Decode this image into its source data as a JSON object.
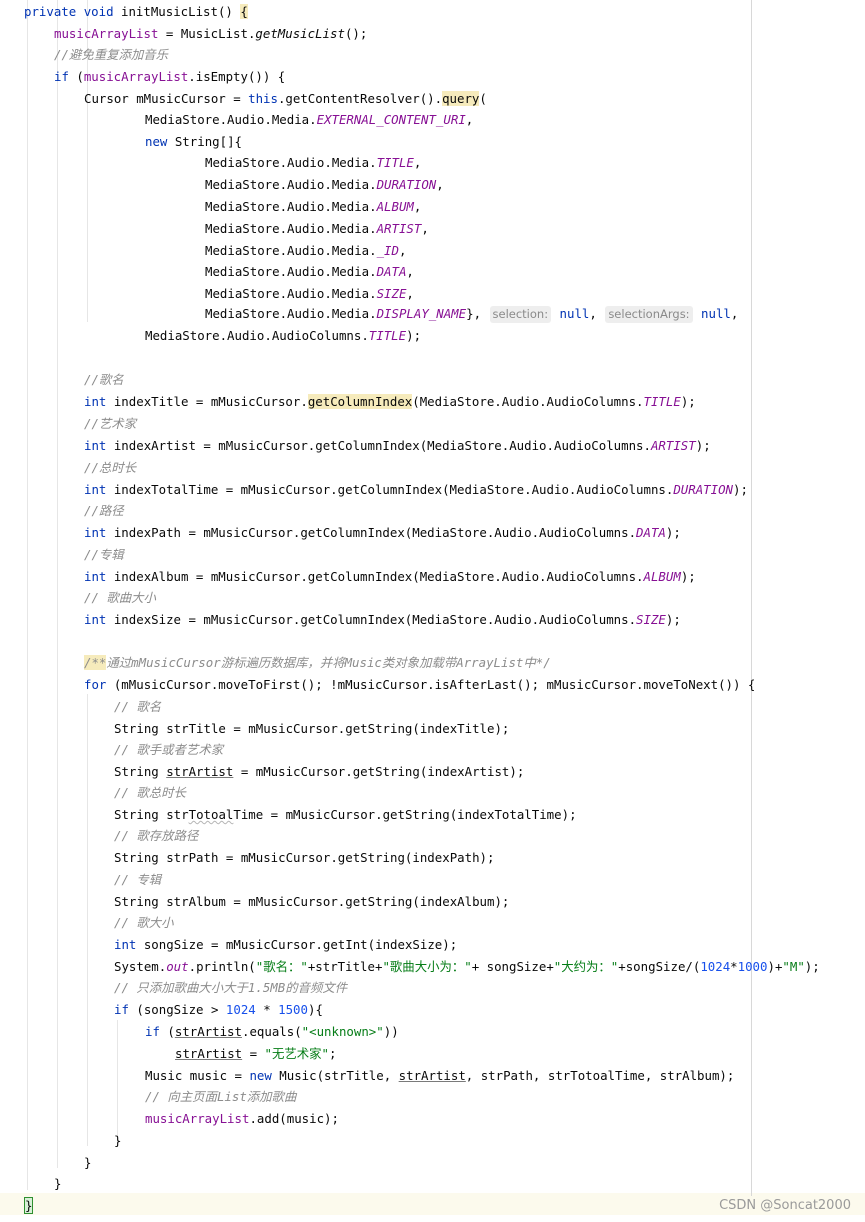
{
  "code": {
    "l01": {
      "a": "private",
      "b": "void",
      "c": "initMusicList() ",
      "d": "{"
    },
    "l02": {
      "a": "musicArrayList",
      "b": " = MusicList.",
      "c": "getMusicList",
      "d": "();"
    },
    "l03": {
      "a": "//避免重复添加音乐"
    },
    "l04": {
      "a": "if",
      "b": " (",
      "c": "musicArrayList",
      "d": ".isEmpty()) {"
    },
    "l05": {
      "a": "Cursor mMusicCursor = ",
      "b": "this",
      "c": ".getContentResolver().",
      "d": "query",
      "e": "("
    },
    "l06": {
      "a": "MediaStore.Audio.Media.",
      "b": "EXTERNAL_CONTENT_URI",
      "c": ","
    },
    "l07": {
      "a": "new",
      "b": " String[]{"
    },
    "l08": {
      "a": "MediaStore.Audio.Media.",
      "b": "TITLE",
      "c": ","
    },
    "l09": {
      "a": "MediaStore.Audio.Media.",
      "b": "DURATION",
      "c": ","
    },
    "l10": {
      "a": "MediaStore.Audio.Media.",
      "b": "ALBUM",
      "c": ","
    },
    "l11": {
      "a": "MediaStore.Audio.Media.",
      "b": "ARTIST",
      "c": ","
    },
    "l12": {
      "a": "MediaStore.Audio.Media.",
      "b": "_ID",
      "c": ","
    },
    "l13": {
      "a": "MediaStore.Audio.Media.",
      "b": "DATA",
      "c": ","
    },
    "l14": {
      "a": "MediaStore.Audio.Media.",
      "b": "SIZE",
      "c": ","
    },
    "l15": {
      "a": "MediaStore.Audio.Media.",
      "b": "DISPLAY_NAME",
      "c": "}, ",
      "h1": "selection:",
      "d": "null",
      "e": ", ",
      "h2": "selectionArgs:",
      "f": "null",
      "g": ","
    },
    "l16": {
      "a": "MediaStore.Audio.AudioColumns.",
      "b": "TITLE",
      "c": ");"
    },
    "l18": {
      "a": "//歌名"
    },
    "l19": {
      "a": "int",
      "b": " indexTitle = mMusicCursor.",
      "c": "getColumnIndex",
      "d": "(MediaStore.Audio.AudioColumns.",
      "e": "TITLE",
      "f": ");"
    },
    "l20": {
      "a": "//艺术家"
    },
    "l21": {
      "a": "int",
      "b": " indexArtist = mMusicCursor.getColumnIndex(MediaStore.Audio.AudioColumns.",
      "e": "ARTIST",
      "f": ");"
    },
    "l22": {
      "a": "//总时长"
    },
    "l23": {
      "a": "int",
      "b": " indexTotalTime = mMusicCursor.getColumnIndex(MediaStore.Audio.AudioColumns.",
      "e": "DURATION",
      "f": ");"
    },
    "l24": {
      "a": "//路径"
    },
    "l25": {
      "a": "int",
      "b": " indexPath = mMusicCursor.getColumnIndex(MediaStore.Audio.AudioColumns.",
      "e": "DATA",
      "f": ");"
    },
    "l26": {
      "a": "//专辑"
    },
    "l27": {
      "a": "int",
      "b": " indexAlbum = mMusicCursor.getColumnIndex(MediaStore.Audio.AudioColumns.",
      "e": "ALBUM",
      "f": ");"
    },
    "l28": {
      "a": "// 歌曲大小"
    },
    "l29": {
      "a": "int",
      "b": " indexSize = mMusicCursor.getColumnIndex(MediaStore.Audio.AudioColumns.",
      "e": "SIZE",
      "f": ");"
    },
    "l31": {
      "a": "/**",
      "b": "通过mMusicCursor游标遍历数据库，并将Music类对象加载带ArrayList中*/"
    },
    "l32": {
      "a": "for",
      "b": " (mMusicCursor.moveToFirst(); !mMusicCursor.isAfterLast(); mMusicCursor.moveToNext()) {"
    },
    "l33": {
      "a": "// 歌名"
    },
    "l34": {
      "a": "String strTitle = mMusicCursor.getString(indexTitle);"
    },
    "l35": {
      "a": "// 歌手或者艺术家"
    },
    "l36": {
      "a": "String ",
      "b": "strArtist",
      "c": " = mMusicCursor.getString(indexArtist);"
    },
    "l37": {
      "a": "// 歌总时长"
    },
    "l38": {
      "a": "String str",
      "b": "Totoal",
      "c": "Time = mMusicCursor.getString(indexTotalTime);"
    },
    "l39": {
      "a": "// 歌存放路径"
    },
    "l40": {
      "a": "String strPath = mMusicCursor.getString(indexPath);"
    },
    "l41": {
      "a": "// 专辑"
    },
    "l42": {
      "a": "String strAlbum = mMusicCursor.getString(indexAlbum);"
    },
    "l43": {
      "a": "// 歌大小"
    },
    "l44": {
      "a": "int",
      "b": " songSize = mMusicCursor.getInt(indexSize);"
    },
    "l45": {
      "a": "System.",
      "b": "out",
      "c": ".println(",
      "d": "\"歌名：\"",
      "e": "+strTitle+",
      "f": "\"歌曲大小为：\"",
      "g": "+ songSize+",
      "h": "\"大约为：\"",
      "i": "+songSize/(",
      "j": "1024",
      "k": "*",
      "l": "1000",
      "m": ")+",
      "n": "\"M\"",
      "o": ");"
    },
    "l46": {
      "a": "// 只添加歌曲大小大于1.5MB的音频文件"
    },
    "l47": {
      "a": "if",
      "b": " (songSize > ",
      "c": "1024",
      "d": " * ",
      "e": "1500",
      "f": "){"
    },
    "l48": {
      "a": "if",
      "b": " (",
      "c": "strArtist",
      "d": ".equals(",
      "e": "\"<unknown>\"",
      "f": "))"
    },
    "l49": {
      "a": "strArtist",
      "b": " = ",
      "c": "\"无艺术家\"",
      "d": ";"
    },
    "l50": {
      "a": "Music music = ",
      "b": "new",
      "c": " Music(strTitle, ",
      "d": "strArtist",
      "e": ", strPath, strTotoalTime, strAlbum);"
    },
    "l51": {
      "a": "// 向主页面List添加歌曲"
    },
    "l52": {
      "a": "musicArrayList",
      "b": ".add(music);"
    },
    "l53": {
      "a": "}"
    },
    "l54": {
      "a": "}"
    },
    "l55": {
      "a": "}"
    },
    "l56": {
      "a": "}"
    }
  },
  "watermark": "CSDN @Soncat2000",
  "colors": {
    "keyword": "#0033b3",
    "field": "#871094",
    "string": "#067d17",
    "number": "#1750eb",
    "comment": "#8c8c8c",
    "highlight": "#f6ebbc"
  }
}
